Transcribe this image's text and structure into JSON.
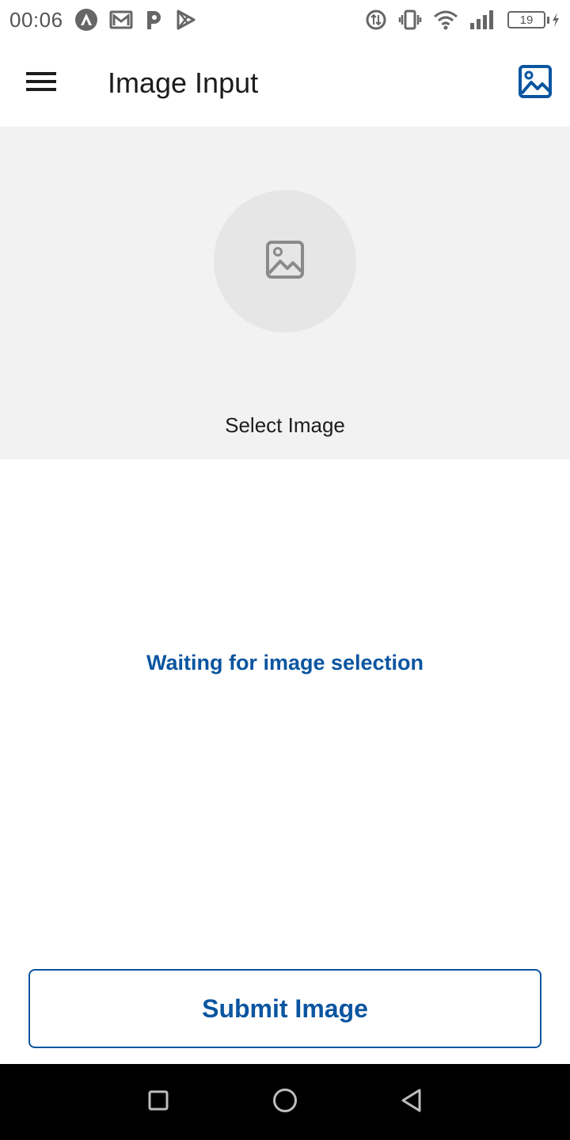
{
  "status_bar": {
    "time": "00:06",
    "battery_level": "19",
    "left_icons": [
      "arch-linux-icon",
      "mail-icon",
      "p-app-icon",
      "play-store-icon"
    ],
    "right_icons": [
      "data-saver-icon",
      "vibrate-icon",
      "wifi-icon",
      "signal-icon",
      "battery-icon",
      "charging-icon"
    ]
  },
  "app_bar": {
    "title": "Image Input",
    "menu_icon": "menu-icon",
    "action_icon": "image-icon"
  },
  "select_panel": {
    "label": "Select Image",
    "placeholder_icon": "image-placeholder-icon"
  },
  "status": {
    "message": "Waiting for image selection"
  },
  "submit": {
    "label": "Submit Image"
  },
  "nav_bar": {
    "buttons": [
      "recents-icon",
      "home-icon",
      "back-icon"
    ]
  },
  "colors": {
    "accent": "#0b55a0",
    "panel_bg": "#f2f2f2",
    "circle_bg": "#e6e6e6",
    "nav_bg": "#000000"
  }
}
